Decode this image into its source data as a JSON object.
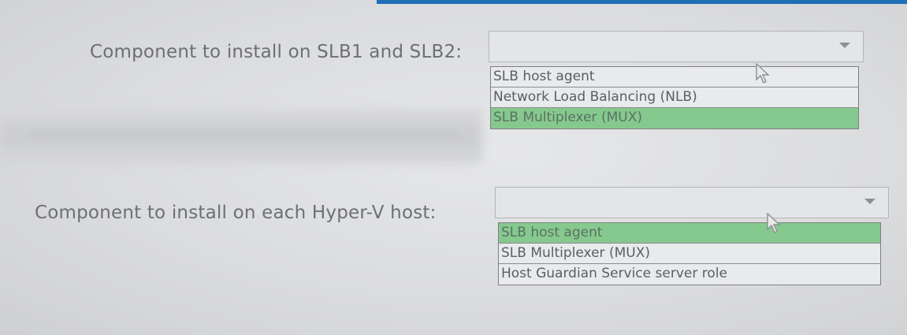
{
  "colors": {
    "selected_highlight": "#86c98e",
    "label_text": "#6d6f74",
    "accent_bar": "#1f6fb6"
  },
  "question1": {
    "label": "Component to install on SLB1 and SLB2:",
    "selected_value": "",
    "options": [
      {
        "label": "SLB host agent",
        "selected": false
      },
      {
        "label": "Network Load Balancing (NLB)",
        "selected": false
      },
      {
        "label": "SLB Multiplexer (MUX)",
        "selected": true
      }
    ]
  },
  "question2": {
    "label": "Component to install on each Hyper-V host:",
    "selected_value": "",
    "options": [
      {
        "label": "SLB host agent",
        "selected": true
      },
      {
        "label": "SLB Multiplexer (MUX)",
        "selected": false
      },
      {
        "label": "Host Guardian Service server role",
        "selected": false
      }
    ]
  },
  "icons": {
    "dropdown_arrow": "chevron-down-icon",
    "pointer": "mouse-cursor-icon"
  }
}
